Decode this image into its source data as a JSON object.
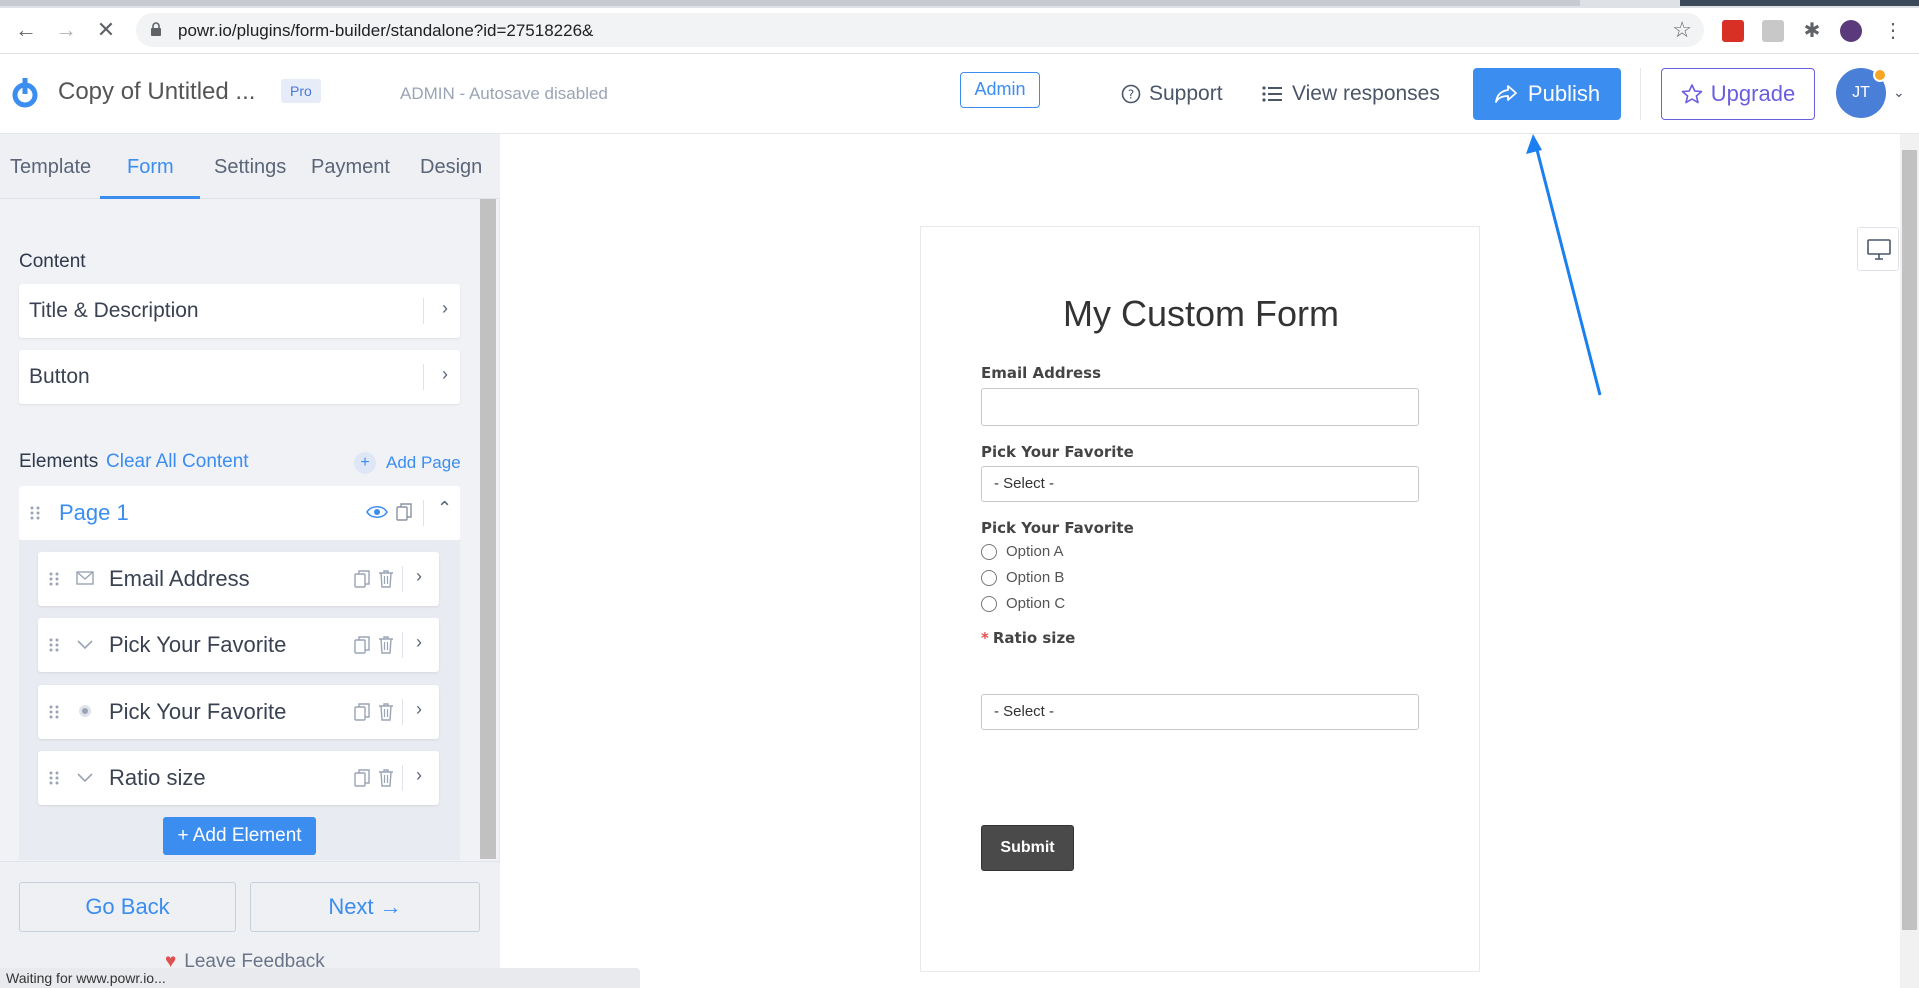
{
  "browser": {
    "url": "powr.io/plugins/form-builder/standalone?id=27518226&",
    "status": "Waiting for www.powr.io..."
  },
  "header": {
    "title": "Copy of Untitled ...",
    "badge": "Pro",
    "autosave": "ADMIN - Autosave disabled",
    "admin_label": "Admin",
    "support_label": "Support",
    "responses_label": "View responses",
    "publish_label": "Publish",
    "upgrade_label": "Upgrade",
    "avatar_initials": "JT"
  },
  "sidebar": {
    "tabs": [
      {
        "label": "Template"
      },
      {
        "label": "Form"
      },
      {
        "label": "Settings"
      },
      {
        "label": "Payment"
      },
      {
        "label": "Design"
      }
    ],
    "active_tab": "Form",
    "content_heading": "Content",
    "content_items": [
      {
        "label": "Title & Description"
      },
      {
        "label": "Button"
      }
    ],
    "elements_heading": "Elements",
    "clear_all": "Clear All Content",
    "add_page": "Add Page",
    "page_label": "Page 1",
    "elements": [
      {
        "label": "Email Address",
        "icon": "envelope-icon"
      },
      {
        "label": "Pick Your Favorite",
        "icon": "dropdown-chevron-icon"
      },
      {
        "label": "Pick Your Favorite",
        "icon": "radio-icon"
      },
      {
        "label": "Ratio size",
        "icon": "dropdown-chevron-icon"
      }
    ],
    "add_element": "+ Add Element",
    "go_back": "Go Back",
    "next": "Next →",
    "feedback": "Leave Feedback"
  },
  "form": {
    "title": "My Custom Form",
    "email_label": "Email Address",
    "favorite_select_label": "Pick Your Favorite",
    "favorite_select_value": "- Select -",
    "favorite_radio_label": "Pick Your Favorite",
    "options": [
      "Option A",
      "Option B",
      "Option C"
    ],
    "required_mark": "*",
    "ratio_label": "Ratio size",
    "ratio_value": "- Select -",
    "submit": "Submit"
  },
  "colors": {
    "accent": "#3b8df0",
    "upgrade": "#6a5ee0",
    "submit_bg": "#4a4a4a",
    "arrow": "#1a7ff0"
  }
}
